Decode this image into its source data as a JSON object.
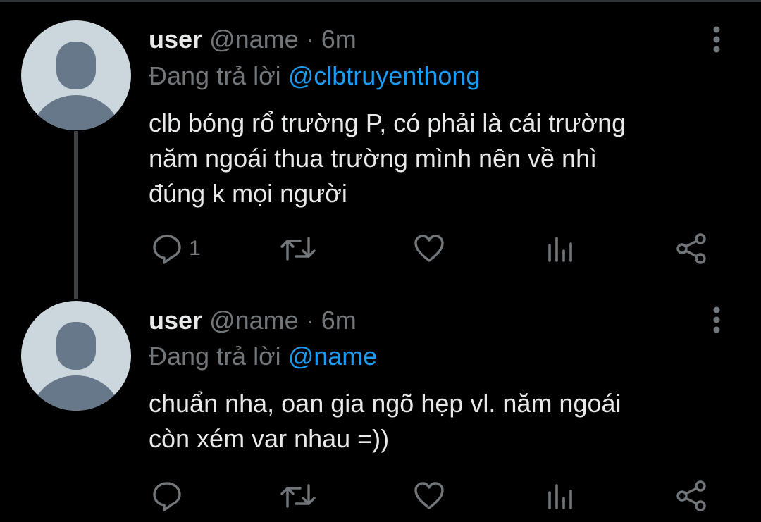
{
  "tweets": [
    {
      "display_name": "user",
      "handle": "@name",
      "separator": "·",
      "time": "6m",
      "reply_prefix": "Đang trả lời",
      "reply_to": "@clbtruyenthong",
      "text_lines": [
        "clb bóng rổ trường P, có phải là cái trường",
        "năm ngoái thua trường mình nên về nhì",
        "đúng k mọi người"
      ],
      "actions": {
        "reply_count": "1",
        "retweet_count": "",
        "like_count": "",
        "views_count": ""
      }
    },
    {
      "display_name": "user",
      "handle": "@name",
      "separator": "·",
      "time": "6m",
      "reply_prefix": "Đang trả lời",
      "reply_to": "@name",
      "text_lines": [
        "chuẩn nha, oan gia ngõ hẹp vl. năm ngoái",
        "còn xém var nhau =))"
      ],
      "actions": {
        "reply_count": "",
        "retweet_count": "",
        "like_count": "",
        "views_count": ""
      }
    }
  ],
  "icons": {
    "reply": "speech-bubble-icon",
    "retweet": "retweet-icon",
    "like": "heart-icon",
    "views": "bar-chart-icon",
    "share": "share-icon",
    "more": "vertical-ellipsis-icon"
  },
  "colors": {
    "background": "#000000",
    "primary_text": "#e7e9ea",
    "secondary_text": "#71767b",
    "mention": "#1d9bf0",
    "avatar_bg": "#ccd6dd",
    "avatar_fg": "#67788a",
    "thread_line": "#3e4144"
  }
}
